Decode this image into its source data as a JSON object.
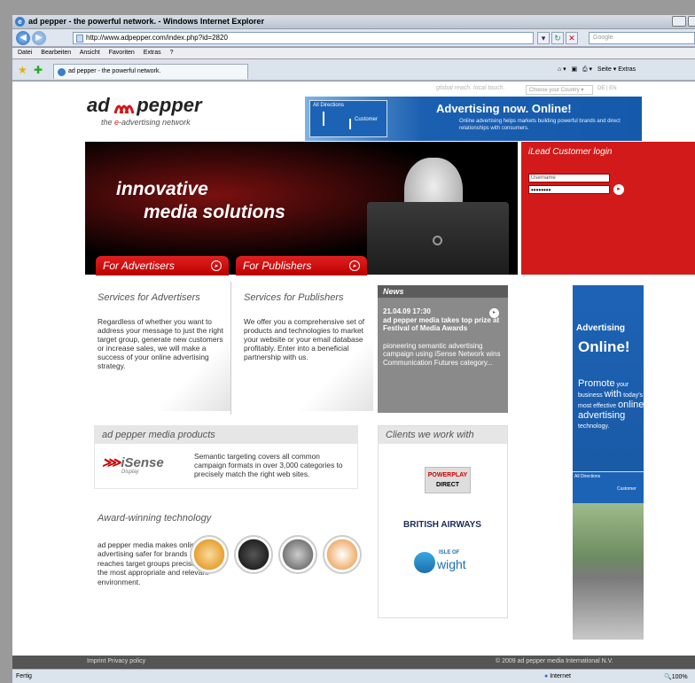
{
  "window": {
    "title": "ad pepper - the powerful network. - Windows Internet Explorer"
  },
  "address": {
    "url": "http://www.adpepper.com/index.php?id=2820",
    "search_placeholder": "Google"
  },
  "menu": [
    "Datei",
    "Bearbeiten",
    "Ansicht",
    "Favoriten",
    "Extras",
    "?"
  ],
  "tab": {
    "label": "ad pepper - the powerful network.",
    "tools": "Seite ▾  Extras"
  },
  "header": {
    "logo_left": "ad",
    "logo_right": "pepper",
    "tagline_pre": "the ",
    "tagline_e": "e",
    "tagline_post": "-advertising network",
    "toplinks": "global reach. local touch.",
    "country": "Choose your Country ▾",
    "lang": "DE | EN"
  },
  "banner": {
    "sign_top": "All Directions",
    "sign_customer": "Customer",
    "headline": "Advertising now. Online!",
    "sub": "Online advertising helps markets building powerful brands and direct relationships with consumers."
  },
  "hero": {
    "line1": "innovative",
    "line2": "media solutions"
  },
  "login": {
    "title": "iLead Customer login",
    "username_placeholder": "Username",
    "password_mask": "••••••••"
  },
  "buttons": {
    "advertisers": "For Advertisers",
    "publishers": "For Publishers",
    "arrow": "▸"
  },
  "services": [
    {
      "title": "Services for Advertisers",
      "text": "Regardless of whether you want to address your message to just the right target group, generate new customers or increase sales, we will make a success of your online advertising strategy."
    },
    {
      "title": "Services for Publishers",
      "text": "We offer you a comprehensive set of products and technologies to market your website or your email database profitably. Enter into a beneficial partnership with us."
    }
  ],
  "news": {
    "title": "News",
    "date": "21.04.09 17:30",
    "headline": "ad pepper media takes top prize at Festival of Media Awards",
    "text": "pioneering semantic advertising campaign using iSense Network wins Communication Futures category..."
  },
  "products": {
    "title": "ad pepper media products",
    "logo": "iSense",
    "logo_sub": "Display",
    "text": "Semantic targeting covers all common campaign formats in over 3,000 categories to precisely match the right web sites."
  },
  "award": {
    "title": "Award-winning technology",
    "text": "ad pepper media makes online advertising safer for brands and reaches target groups precisely in the most appropriate and relevant environment."
  },
  "clients": {
    "title": "Clients we work with",
    "items": [
      "POWERPLAY",
      "DIRECT",
      "BRITISH AIRWAYS",
      "ISLE OF",
      "wight"
    ]
  },
  "rightad": {
    "l1": "Advertising",
    "l2": "Online!",
    "p1": "Promote",
    "p1b": " your business ",
    "p2": "with",
    "p2b": " today's most effective ",
    "p3": "online advertising",
    "p3b": " technology.",
    "sign_top": "All Directions",
    "sign_customer": "Customer"
  },
  "footer": {
    "left": "Imprint  Privacy policy",
    "right": "© 2009 ad pepper media International N.V."
  },
  "status": {
    "left": "Fertig",
    "zone": "Internet",
    "zoom": "100%"
  }
}
